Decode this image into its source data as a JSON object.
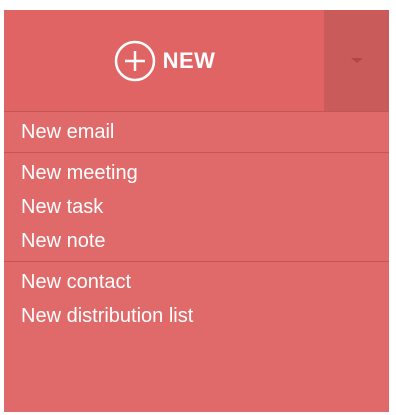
{
  "new_button": {
    "label": "NEW",
    "icon": "plus-circle-icon",
    "toggle_icon": "caret-down-icon"
  },
  "menu": {
    "sections": [
      [
        "New email"
      ],
      [
        "New meeting",
        "New task",
        "New note"
      ],
      [
        "New contact",
        "New distribution list"
      ]
    ]
  },
  "colors": {
    "background": "#e06a6a",
    "toggle": "#c95b5b",
    "divider": "#c45555",
    "text": "#ffffff"
  }
}
